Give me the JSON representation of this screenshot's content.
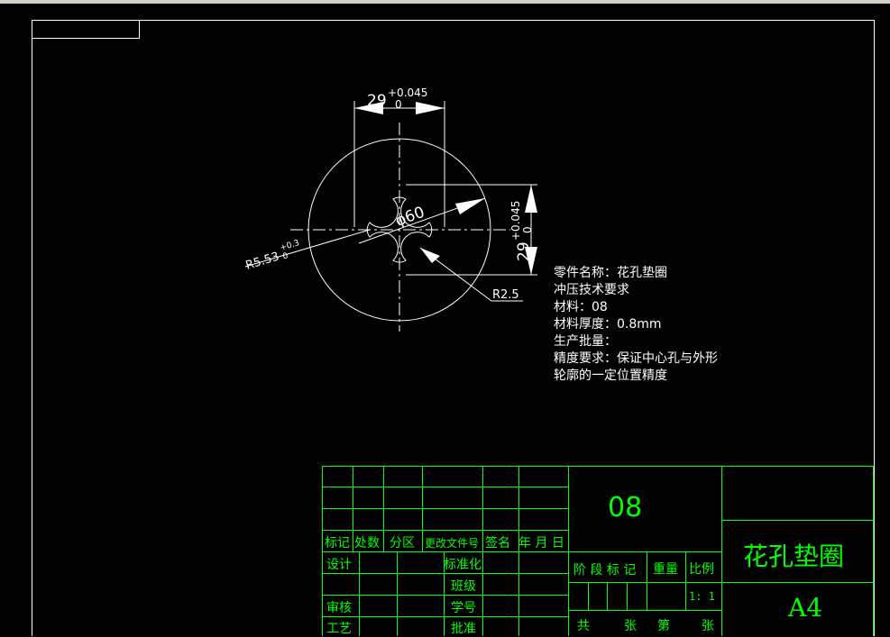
{
  "drawing": {
    "dim_width": {
      "value": "29",
      "upper": "+0.045",
      "lower": "0"
    },
    "dim_diameter": "φ60",
    "dim_height": {
      "value": "29",
      "upper": "+0.045",
      "lower": "0"
    },
    "dim_radius_small": {
      "value": "R5.53",
      "upper": "+0.3",
      "lower": "0"
    },
    "dim_radius_corner": "R2.5"
  },
  "notes": [
    "零件名称：花孔垫圈",
    "冲压技术要求",
    "材料：08",
    "材料厚度：0.8mm",
    "生产批量：",
    "精度要求：保证中心孔与外形",
    "轮廓的一定位置精度"
  ],
  "title_block": {
    "material": "08",
    "part_name": "花孔垫圈",
    "sheet_size": "A4",
    "scale": "1: 1",
    "rev_headers": [
      "标记",
      "处数",
      "分区",
      "更改文件号",
      "签名",
      "年 月 日"
    ],
    "design": "设计",
    "standardize": "标准化",
    "class": "班级",
    "review": "审核",
    "student_id": "学号",
    "process": "工艺",
    "approve": "批准",
    "stage_mark": "阶 段 标 记",
    "weight": "重量",
    "ratio": "比例",
    "total": "共",
    "sheets": "张",
    "sheet_no": "第",
    "sheets2": "张"
  }
}
